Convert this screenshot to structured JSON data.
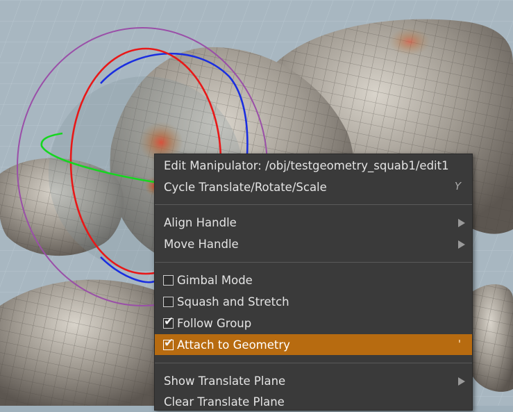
{
  "context_menu": {
    "title": "Edit Manipulator: /obj/testgeometry_squab1/edit1",
    "cycle": {
      "label": "Cycle Translate/Rotate/Scale",
      "shortcut": "Y"
    },
    "align_handle": {
      "label": "Align Handle",
      "icon": "submenu-arrow-icon"
    },
    "move_handle": {
      "label": "Move Handle",
      "icon": "submenu-arrow-icon"
    },
    "gimbal_mode": {
      "label": "Gimbal Mode",
      "checked": false
    },
    "squash_stretch": {
      "label": "Squash and Stretch",
      "checked": false
    },
    "follow_group": {
      "label": "Follow Group",
      "checked": true
    },
    "attach_geometry": {
      "label": "Attach to Geometry",
      "checked": true,
      "shortcut": "'",
      "highlighted": true
    },
    "show_translate_plane": {
      "label": "Show Translate Plane",
      "icon": "submenu-arrow-icon"
    },
    "clear_translate_plane": {
      "label": "Clear Translate Plane"
    },
    "checkmark_glyph": "✔"
  },
  "colors": {
    "menu_background": "#3a3a3a",
    "highlight": "#b76b10",
    "text": "#e4e4e4"
  }
}
